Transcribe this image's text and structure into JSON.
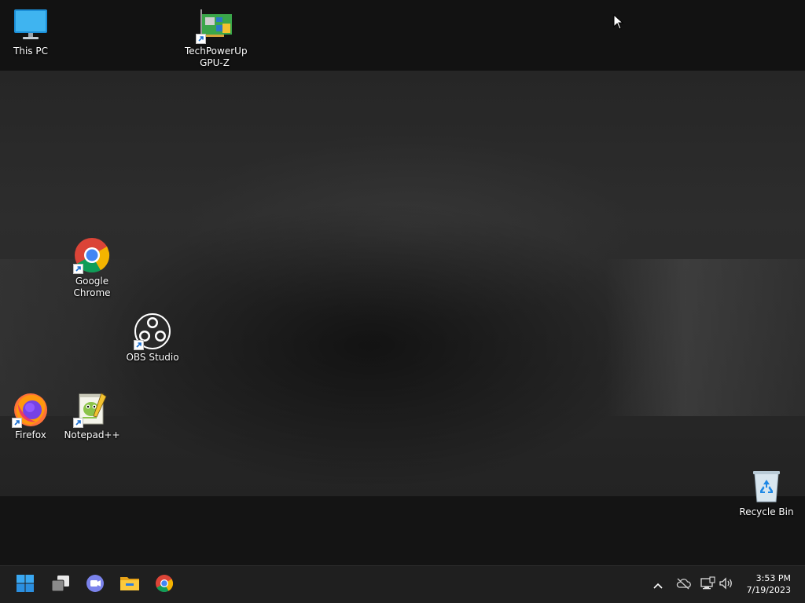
{
  "desktop": {
    "icons": [
      {
        "label": "This PC",
        "icon": "monitor-icon"
      },
      {
        "label": "TechPowerUp GPU-Z",
        "icon": "gpu-card-icon",
        "shortcut": true
      },
      {
        "label": "Google Chrome",
        "icon": "chrome-icon",
        "shortcut": true
      },
      {
        "label": "OBS Studio",
        "icon": "obs-icon",
        "shortcut": true
      },
      {
        "label": "Firefox",
        "icon": "firefox-icon",
        "shortcut": true
      },
      {
        "label": "Notepad++",
        "icon": "notepadpp-icon",
        "shortcut": true
      },
      {
        "label": "Recycle Bin",
        "icon": "recycle-bin-icon"
      }
    ]
  },
  "taskbar": {
    "pinned": [
      {
        "name": "Start",
        "icon": "windows-start-icon"
      },
      {
        "name": "Task View",
        "icon": "task-view-icon"
      },
      {
        "name": "Chat",
        "icon": "teams-chat-icon"
      },
      {
        "name": "File Explorer",
        "icon": "folder-icon"
      },
      {
        "name": "Google Chrome",
        "icon": "chrome-icon"
      }
    ],
    "tray": [
      {
        "name": "Show hidden icons",
        "icon": "chevron-up-icon"
      },
      {
        "name": "OneDrive",
        "icon": "cloud-icon"
      },
      {
        "name": "Network",
        "icon": "network-icon"
      },
      {
        "name": "Volume",
        "icon": "speaker-icon"
      }
    ],
    "clock": {
      "time": "3:53 PM",
      "date": "7/19/2023"
    }
  },
  "colors": {
    "taskbar_bg": "#1f1f1f",
    "windows_blue": "#0078d4"
  }
}
